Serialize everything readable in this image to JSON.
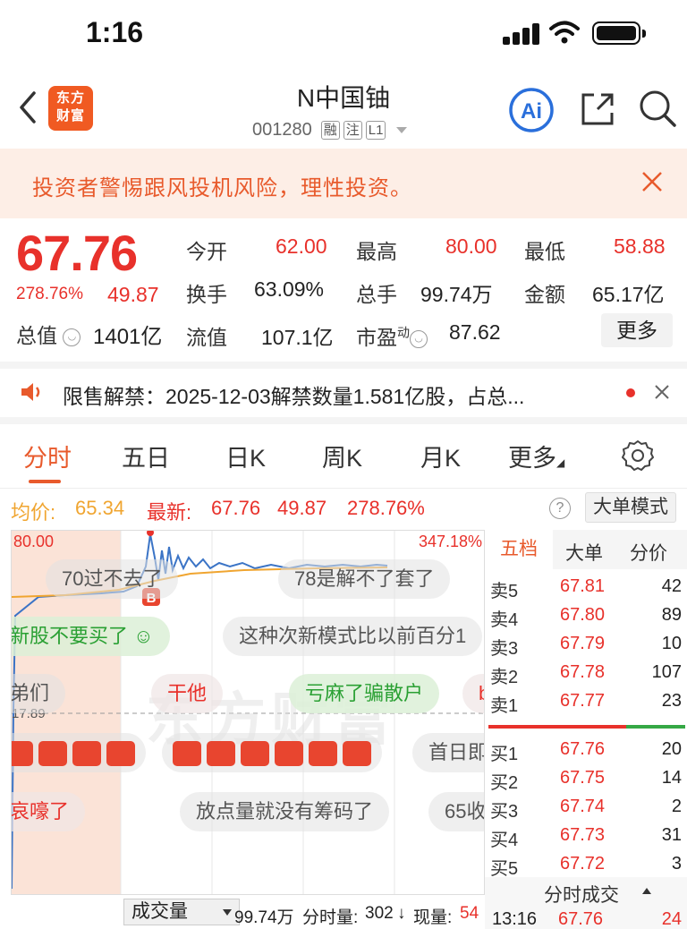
{
  "status": {
    "time": "1:16"
  },
  "nav": {
    "logo_line1": "东方",
    "logo_line2": "财富",
    "stock_name": "N中国铀",
    "stock_code": "001280",
    "tags": [
      "融",
      "注",
      "L1"
    ],
    "ai_label": "Ai"
  },
  "banner": {
    "text": "投资者警惕跟风投机风险，理性投资。"
  },
  "quote": {
    "price": "67.76",
    "change_pct": "278.76%",
    "change": "49.87",
    "total_value_label": "总值",
    "total_value": "1401亿",
    "fields": [
      {
        "k": "今开",
        "v": "62.00",
        "red": true
      },
      {
        "k": "最高",
        "v": "80.00",
        "red": true
      },
      {
        "k": "最低",
        "v": "58.88",
        "red": true
      },
      {
        "k": "换手",
        "v": "63.09%",
        "red": false
      },
      {
        "k": "总手",
        "v": "99.74万",
        "red": false
      },
      {
        "k": "金额",
        "v": "65.17亿",
        "red": false
      },
      {
        "k": "流值",
        "v": "107.1亿",
        "red": false
      },
      {
        "k": "市盈",
        "v": "87.62",
        "red": false
      }
    ],
    "pe_sup": "动",
    "more_label": "更多"
  },
  "notice": {
    "text": "限售解禁：2025-12-03解禁数量1.581亿股，占总..."
  },
  "tabs": [
    "分时",
    "五日",
    "日K",
    "周K",
    "月K",
    "更多"
  ],
  "avg_row": {
    "avg_label": "均价:",
    "avg_value": "65.34",
    "latest_label": "最新:",
    "latest_value": "67.76",
    "latest_change": "49.87",
    "latest_pct": "278.76%",
    "big_mode": "大单模式"
  },
  "chart": {
    "high_label": "80.00",
    "high_pct": "347.18%",
    "mid_label": "17.89",
    "b_marker": "B",
    "watermark": "东方财富",
    "danmu": [
      {
        "text": "70过不去了",
        "style": "gray"
      },
      {
        "text": "78是解不了套了",
        "style": "gray"
      },
      {
        "text": "新股不要买了",
        "style": "green"
      },
      {
        "text": "这种次新模式比以前百分1",
        "style": "gray"
      },
      {
        "text": "弟们",
        "style": "gray"
      },
      {
        "text": "干他",
        "style": "red"
      },
      {
        "text": "亏麻了骗散户",
        "style": "green"
      },
      {
        "text": "b",
        "style": "red"
      },
      {
        "text": "首日即",
        "style": "gray"
      },
      {
        "text": "哀嚎了",
        "style": "red"
      },
      {
        "text": "放点量就没有筹码了",
        "style": "gray"
      },
      {
        "text": "65收",
        "style": "gray"
      }
    ]
  },
  "chart_data": {
    "type": "line",
    "series": [
      {
        "name": "最新",
        "color": "#3b74c6"
      },
      {
        "name": "均价",
        "color": "#f0a530"
      }
    ],
    "ylim": [
      17.89,
      80.0
    ],
    "ticks": [
      "80.00",
      "17.89"
    ],
    "pct_label": "347.18%"
  },
  "volume": {
    "selector": "成交量",
    "total": "99.74万",
    "minute_label": "分时量:",
    "minute_value": "302",
    "now_label": "现量:",
    "now_value": "54"
  },
  "orderbook": {
    "tabs": [
      "五档",
      "大单",
      "分价"
    ],
    "sells": [
      {
        "label": "卖5",
        "price": "67.81",
        "vol": "42"
      },
      {
        "label": "卖4",
        "price": "67.80",
        "vol": "89"
      },
      {
        "label": "卖3",
        "price": "67.79",
        "vol": "10"
      },
      {
        "label": "卖2",
        "price": "67.78",
        "vol": "107"
      },
      {
        "label": "卖1",
        "price": "67.77",
        "vol": "23"
      }
    ],
    "buys": [
      {
        "label": "买1",
        "price": "67.76",
        "vol": "20"
      },
      {
        "label": "买2",
        "price": "67.75",
        "vol": "14"
      },
      {
        "label": "买3",
        "price": "67.74",
        "vol": "2"
      },
      {
        "label": "买4",
        "price": "67.73",
        "vol": "31"
      },
      {
        "label": "买5",
        "price": "67.72",
        "vol": "3"
      }
    ],
    "foot_title": "分时成交",
    "foot_row": {
      "time": "13:16",
      "price": "67.76",
      "vol": "24"
    }
  }
}
